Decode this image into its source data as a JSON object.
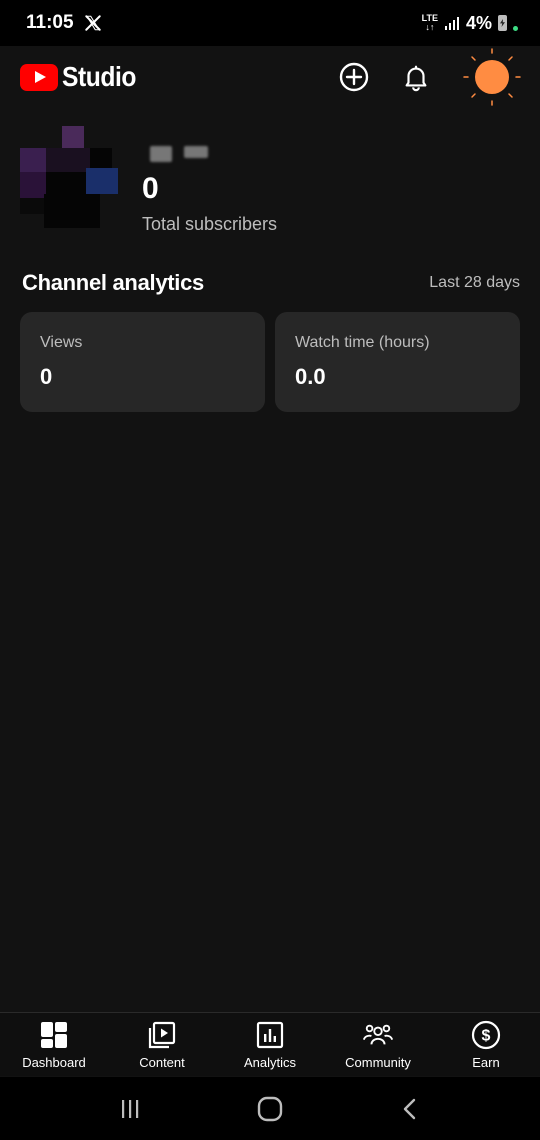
{
  "status_bar": {
    "time": "11:05",
    "network": "LTE",
    "battery": "4%",
    "icons": [
      "x-app-icon",
      "lte-icon",
      "signal-icon",
      "battery-charging-icon"
    ]
  },
  "header": {
    "app_name": "Studio",
    "icons": [
      "create-icon",
      "notifications-icon",
      "account-avatar"
    ]
  },
  "channel": {
    "subscriber_count": "0",
    "subscriber_label": "Total subscribers"
  },
  "analytics": {
    "title": "Channel analytics",
    "range": "Last 28 days",
    "cards": [
      {
        "label": "Views",
        "value": "0"
      },
      {
        "label": "Watch time (hours)",
        "value": "0.0"
      }
    ]
  },
  "bottom_nav": [
    {
      "label": "Dashboard",
      "icon": "dashboard-icon"
    },
    {
      "label": "Content",
      "icon": "content-icon"
    },
    {
      "label": "Analytics",
      "icon": "analytics-icon"
    },
    {
      "label": "Community",
      "icon": "community-icon"
    },
    {
      "label": "Earn",
      "icon": "earn-icon"
    }
  ],
  "system_nav": [
    "recents-icon",
    "home-icon",
    "back-icon"
  ],
  "colors": {
    "background": "#121212",
    "card": "#272727",
    "brand_red": "#ff0000",
    "avatar": "#ff8c42",
    "muted_text": "#bdbdbd"
  }
}
